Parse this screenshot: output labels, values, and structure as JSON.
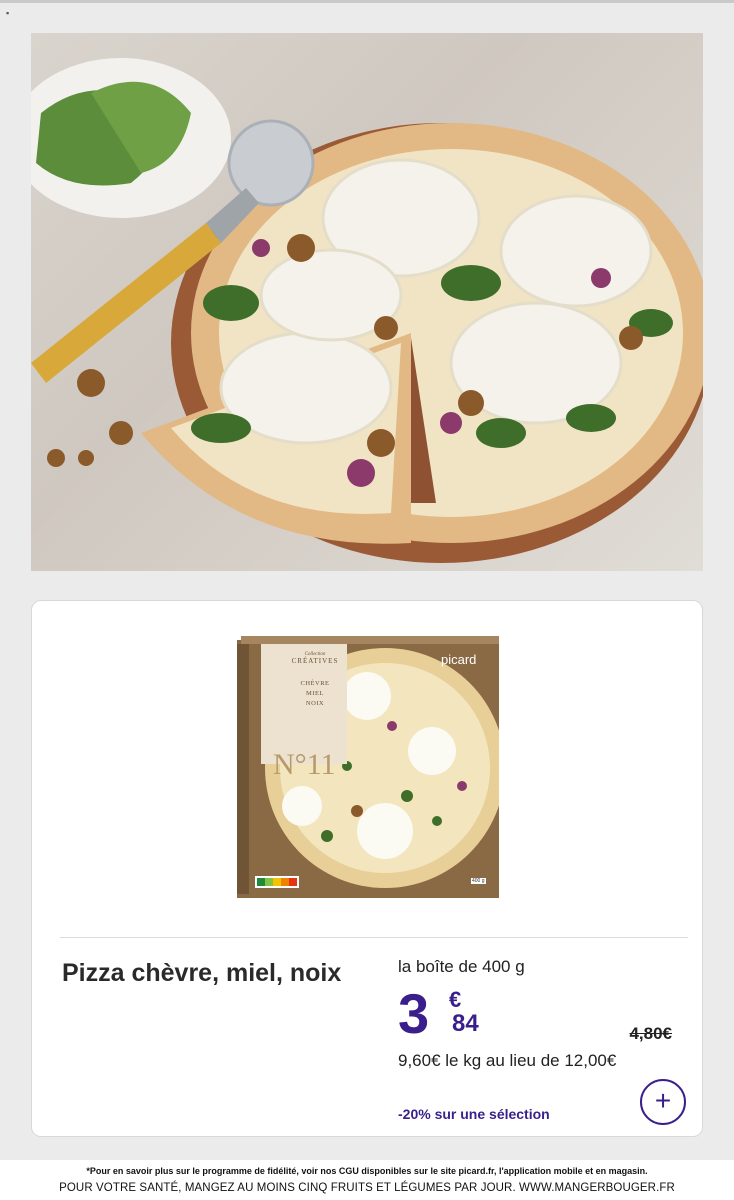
{
  "photo": {
    "alt_icon": "pizza-photo"
  },
  "packaging": {
    "collection": "Collection",
    "brand_line": "CRÉATIVES",
    "flavor_lines": [
      "CHÈVRE",
      "MIEL",
      "NOIX"
    ],
    "number": "N°11",
    "logo": "picard",
    "net_weight": "400 g"
  },
  "product": {
    "title": "Pizza chèvre, miel, noix",
    "weight_label": "la boîte de 400 g",
    "price_int": "3",
    "price_currency": "€",
    "price_dec": "84",
    "old_price": "4,80€",
    "per_kg": "9,60€ le kg au lieu de 12,00€",
    "promo": "-20% sur une sélection",
    "add_label": "+"
  },
  "footer": {
    "fine_print": "*Pour en savoir plus sur le programme de fidélité, voir nos CGU disponibles sur le site picard.fr, l'application mobile et en magasin.",
    "health_message": "POUR VOTRE SANTÉ, MANGEZ AU MOINS CINQ FRUITS ET LÉGUMES PAR JOUR. WWW.MANGERBOUGER.FR"
  },
  "colors": {
    "accent": "#3a1f8c",
    "box_brown": "#8a6a45",
    "crust": "#e2b884"
  }
}
